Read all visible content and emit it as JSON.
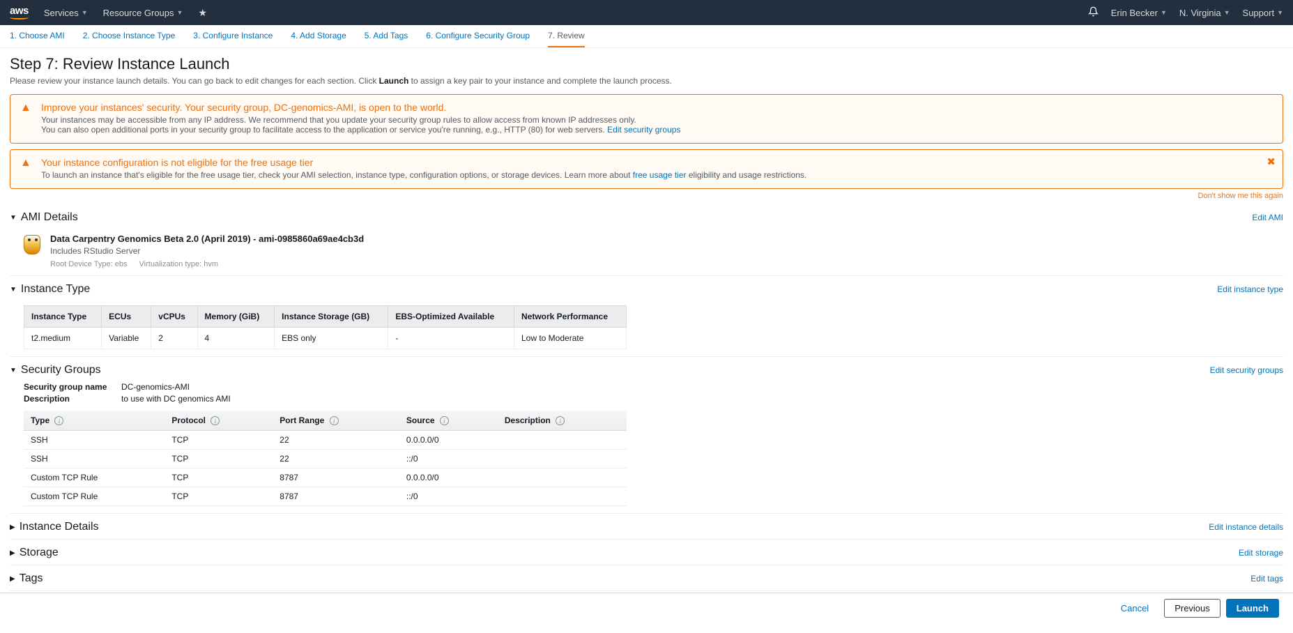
{
  "nav": {
    "logo": "aws",
    "services": "Services",
    "resource_groups": "Resource Groups",
    "user": "Erin Becker",
    "region": "N. Virginia",
    "support": "Support"
  },
  "wizard": {
    "steps": [
      "1. Choose AMI",
      "2. Choose Instance Type",
      "3. Configure Instance",
      "4. Add Storage",
      "5. Add Tags",
      "6. Configure Security Group",
      "7. Review"
    ],
    "active_index": 6
  },
  "page": {
    "title": "Step 7: Review Instance Launch",
    "subtitle_before": "Please review your instance launch details. You can go back to edit changes for each section. Click ",
    "subtitle_bold": "Launch",
    "subtitle_after": " to assign a key pair to your instance and complete the launch process."
  },
  "alert1": {
    "title": "Improve your instances' security. Your security group, DC-genomics-AMI, is open to the world.",
    "line1": "Your instances may be accessible from any IP address. We recommend that you update your security group rules to allow access from known IP addresses only.",
    "line2_before": "You can also open additional ports in your security group to facilitate access to the application or service you're running, e.g., HTTP (80) for web servers. ",
    "line2_link": "Edit security groups"
  },
  "alert2": {
    "title": "Your instance configuration is not eligible for the free usage tier",
    "line_before": "To launch an instance that's eligible for the free usage tier, check your AMI selection, instance type, configuration options, or storage devices. Learn more about ",
    "line_link": "free usage tier",
    "line_after": " eligibility and usage restrictions."
  },
  "dont_show": "Don't show me this again",
  "sections": {
    "ami": {
      "title": "AMI Details",
      "edit": "Edit AMI",
      "name": "Data Carpentry Genomics Beta 2.0 (April 2019) - ami-0985860a69ae4cb3d",
      "desc": "Includes RStudio Server",
      "meta1": "Root Device Type: ebs",
      "meta2": "Virtualization type: hvm"
    },
    "instance_type": {
      "title": "Instance Type",
      "edit": "Edit instance type",
      "headers": [
        "Instance Type",
        "ECUs",
        "vCPUs",
        "Memory (GiB)",
        "Instance Storage (GB)",
        "EBS-Optimized Available",
        "Network Performance"
      ],
      "row": [
        "t2.medium",
        "Variable",
        "2",
        "4",
        "EBS only",
        "-",
        "Low to Moderate"
      ]
    },
    "security_groups": {
      "title": "Security Groups",
      "edit": "Edit security groups",
      "sg_name_label": "Security group name",
      "sg_name_value": "DC-genomics-AMI",
      "sg_desc_label": "Description",
      "sg_desc_value": "to use with DC genomics AMI",
      "headers": [
        "Type",
        "Protocol",
        "Port Range",
        "Source",
        "Description"
      ],
      "rows": [
        [
          "SSH",
          "TCP",
          "22",
          "0.0.0.0/0",
          ""
        ],
        [
          "SSH",
          "TCP",
          "22",
          "::/0",
          ""
        ],
        [
          "Custom TCP Rule",
          "TCP",
          "8787",
          "0.0.0.0/0",
          ""
        ],
        [
          "Custom TCP Rule",
          "TCP",
          "8787",
          "::/0",
          ""
        ]
      ]
    },
    "instance_details": {
      "title": "Instance Details",
      "edit": "Edit instance details"
    },
    "storage": {
      "title": "Storage",
      "edit": "Edit storage"
    },
    "tags": {
      "title": "Tags",
      "edit": "Edit tags"
    }
  },
  "buttons": {
    "cancel": "Cancel",
    "previous": "Previous",
    "launch": "Launch"
  }
}
